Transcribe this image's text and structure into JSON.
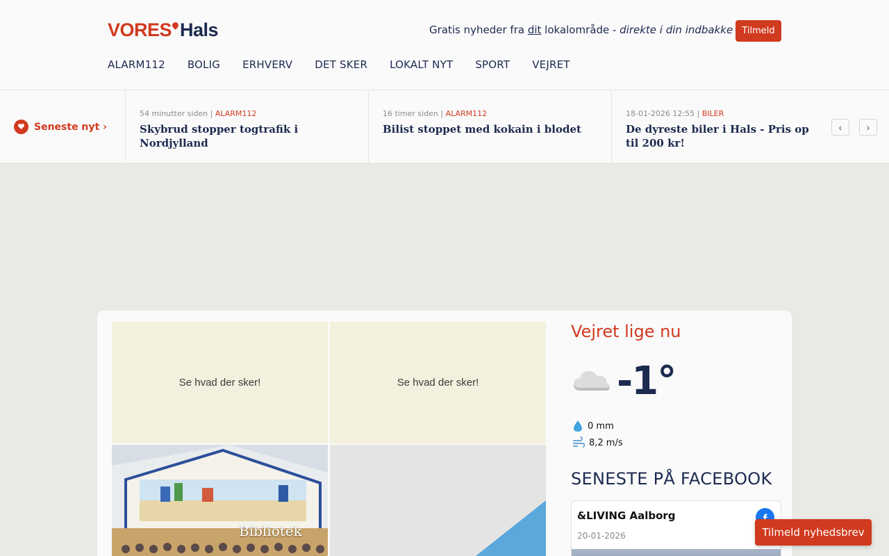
{
  "header": {
    "logo_vores": "VORES",
    "logo_hals": "Hals",
    "tagline_pre": "Gratis nyheder fra ",
    "tagline_dit": "dit",
    "tagline_mid": " lokalområde - ",
    "tagline_em": "direkte i din indbakke",
    "signup_label": "Tilmeld"
  },
  "nav": {
    "items": [
      {
        "label": "ALARM112"
      },
      {
        "label": "BOLIG"
      },
      {
        "label": "ERHVERV"
      },
      {
        "label": "DET SKER"
      },
      {
        "label": "LOKALT NYT"
      },
      {
        "label": "SPORT"
      },
      {
        "label": "VEJRET"
      }
    ]
  },
  "ticker": {
    "label": "Seneste nyt ›",
    "prev": "‹",
    "next": "›",
    "items": [
      {
        "time": "54 minutter siden",
        "category": "ALARM112",
        "title": "Skybrud stopper togtrafik i Nordjylland"
      },
      {
        "time": "16 timer siden",
        "category": "ALARM112",
        "title": "Bilist stoppet med kokain i blodet"
      },
      {
        "time": "18-01-2026 12:55",
        "category": "BILER",
        "title": "De dyreste biler i Hals - Pris op til 200 kr!"
      }
    ]
  },
  "tiles": {
    "tile1": "Se hvad der sker!",
    "tile2": "Se hvad der sker!",
    "sign": "Bibliotek"
  },
  "weather": {
    "title": "Vejret lige nu",
    "icon": "cloud-icon",
    "temperature": "-1°",
    "rain": "0 mm",
    "wind": "8,2 m/s"
  },
  "facebook": {
    "title": "SENESTE PÅ FACEBOOK",
    "author": "&LIVING Aalborg",
    "date": "20-01-2026"
  },
  "newsletter_label": "Tilmeld nyhedsbrev",
  "colors": {
    "accent": "#d03a1f",
    "navy": "#1d2a4f",
    "background": "#e9e9e5"
  }
}
